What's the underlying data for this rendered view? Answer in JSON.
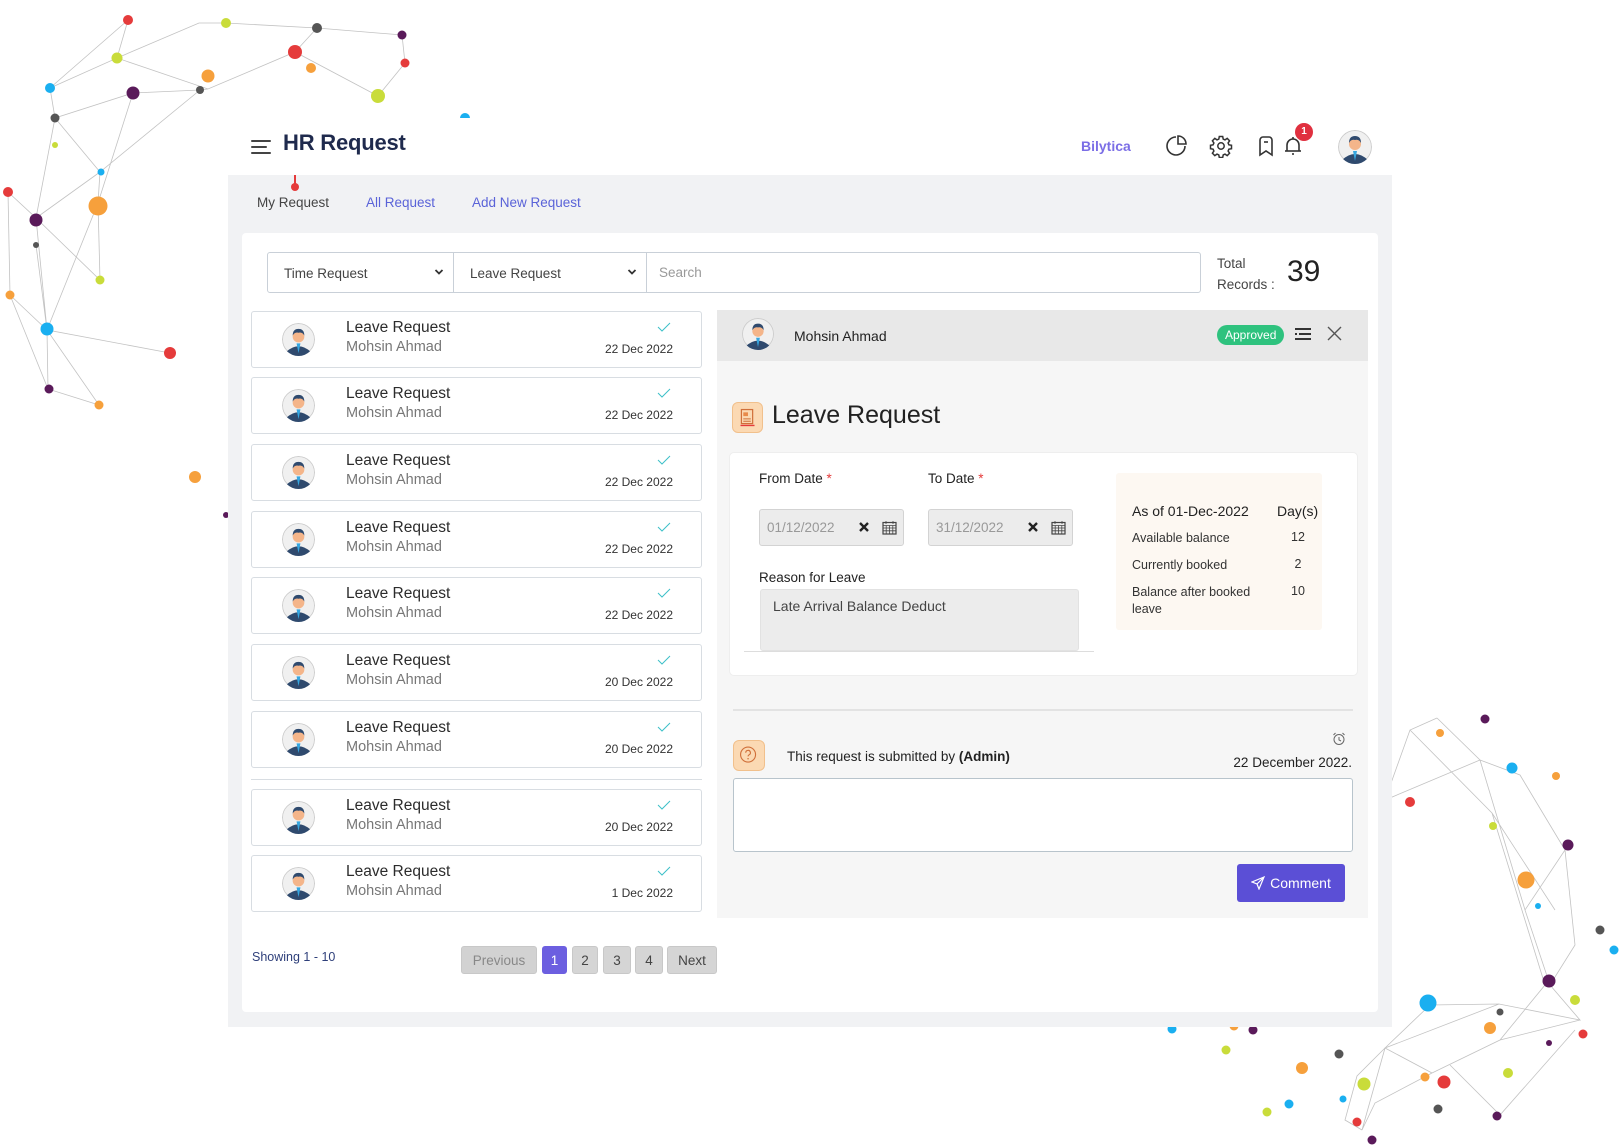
{
  "header": {
    "title": "HR Request",
    "brand": "Bilytica",
    "notification_count": "1",
    "icons": [
      "menu-icon",
      "pie-chart-icon",
      "settings-gear-icon",
      "bookmark-icon",
      "bell-icon",
      "user-avatar"
    ]
  },
  "tabs": [
    {
      "label": "My Request",
      "active": true
    },
    {
      "label": "All Request",
      "active": false
    },
    {
      "label": "Add New Request",
      "active": false
    }
  ],
  "filters": {
    "request_type": "Time Request",
    "request_subtype": "Leave Request",
    "search_placeholder": "Search",
    "search_value": ""
  },
  "total": {
    "label": "Total Records :",
    "value": "39"
  },
  "requests": [
    {
      "title": "Leave Request",
      "name": "Mohsin Ahmad",
      "date": "22 Dec 2022"
    },
    {
      "title": "Leave Request",
      "name": "Mohsin Ahmad",
      "date": "22 Dec 2022"
    },
    {
      "title": "Leave Request",
      "name": "Mohsin Ahmad",
      "date": "22 Dec 2022"
    },
    {
      "title": "Leave Request",
      "name": "Mohsin Ahmad",
      "date": "22 Dec 2022"
    },
    {
      "title": "Leave Request",
      "name": "Mohsin Ahmad",
      "date": "22 Dec 2022"
    },
    {
      "title": "Leave Request",
      "name": "Mohsin Ahmad",
      "date": "20 Dec 2022"
    },
    {
      "title": "Leave Request",
      "name": "Mohsin Ahmad",
      "date": "20 Dec 2022"
    },
    {
      "title": "Leave Request",
      "name": "Mohsin Ahmad",
      "date": "20 Dec 2022"
    },
    {
      "title": "Leave Request",
      "name": "Mohsin Ahmad",
      "date": "1 Dec 2022"
    }
  ],
  "pagination": {
    "showing": "Showing 1 - 10",
    "previous": "Previous",
    "pages": [
      "1",
      "2",
      "3",
      "4"
    ],
    "current": "1",
    "next": "Next"
  },
  "detail": {
    "name": "Mohsin Ahmad",
    "status": "Approved",
    "status_color": "#2ec27e",
    "title": "Leave Request",
    "from_label": "From Date",
    "from_value": "01/12/2022",
    "to_label": "To Date",
    "to_value": "31/12/2022",
    "required_mark": "*",
    "reason_label": "Reason for Leave",
    "reason_value": "Late Arrival Balance Deduct",
    "balance": {
      "heading": "As of 01-Dec-2022",
      "unit_heading": "Day(s)",
      "rows": [
        {
          "label": "Available balance",
          "value": "12"
        },
        {
          "label": "Currently booked",
          "value": "2"
        },
        {
          "label": "Balance after booked leave",
          "value": "10"
        }
      ]
    },
    "submitted_prefix": "This request is submitted by",
    "submitted_by": "(Admin)",
    "submitted_date": "22 December 2022.",
    "comment_value": "",
    "comment_button": "Comment"
  },
  "colors": {
    "accent": "#5b4fd6",
    "brand": "#7b6ee6",
    "tab_link": "#5a63d8",
    "badge_red": "#e0303f",
    "check_teal": "#3cc0c8"
  }
}
